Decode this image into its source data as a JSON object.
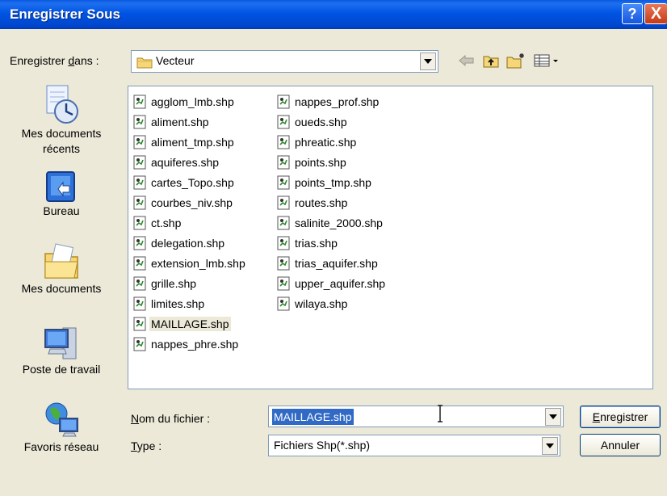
{
  "window": {
    "title": "Enregistrer Sous",
    "help_glyph": "?",
    "close_glyph": "X"
  },
  "save_in": {
    "label_pre": "Enregistrer ",
    "label_mnemonic": "d",
    "label_post": "ans :",
    "value": "Vecteur",
    "icon": "folder-icon"
  },
  "toolbar": {
    "back_icon": "back-arrow-icon",
    "up_icon": "up-folder-icon",
    "new_folder_icon": "new-folder-icon",
    "views_icon": "views-menu-icon"
  },
  "places": [
    {
      "id": "recent",
      "label": "Mes documents récents",
      "icon": "recent-documents-icon"
    },
    {
      "id": "desktop",
      "label": "Bureau",
      "icon": "desktop-icon"
    },
    {
      "id": "mydocs",
      "label": "Mes documents",
      "icon": "my-documents-icon"
    },
    {
      "id": "computer",
      "label": "Poste de travail",
      "icon": "my-computer-icon"
    },
    {
      "id": "network",
      "label": "Favoris réseau",
      "icon": "network-places-icon"
    }
  ],
  "files": {
    "column1": [
      "agglom_lmb.shp",
      "aliment.shp",
      "aliment_tmp.shp",
      "aquiferes.shp",
      "cartes_Topo.shp",
      "courbes_niv.shp",
      "ct.shp",
      "delegation.shp",
      "extension_lmb.shp",
      "grille.shp",
      "limites.shp",
      "MAILLAGE.shp",
      "nappes_phre.shp"
    ],
    "column2": [
      "nappes_prof.shp",
      "oueds.shp",
      "phreatic.shp",
      "points.shp",
      "points_tmp.shp",
      "routes.shp",
      "salinite_2000.shp",
      "trias.shp",
      "trias_aquifer.shp",
      "upper_aquifer.shp",
      "wilaya.shp"
    ],
    "selected": "MAILLAGE.shp"
  },
  "filename": {
    "label_mnemonic": "N",
    "label_post": "om du fichier :",
    "value": "MAILLAGE.shp"
  },
  "filetype": {
    "label_mnemonic": "T",
    "label_post": "ype :",
    "value": "Fichiers Shp(*.shp)"
  },
  "buttons": {
    "save_mnemonic": "E",
    "save_post": "nregistrer",
    "cancel": "Annuler"
  },
  "colors": {
    "titlebar": "#0054e3",
    "dialog_bg": "#ece9d8",
    "selection": "#316ac5",
    "border": "#7f9db9"
  }
}
